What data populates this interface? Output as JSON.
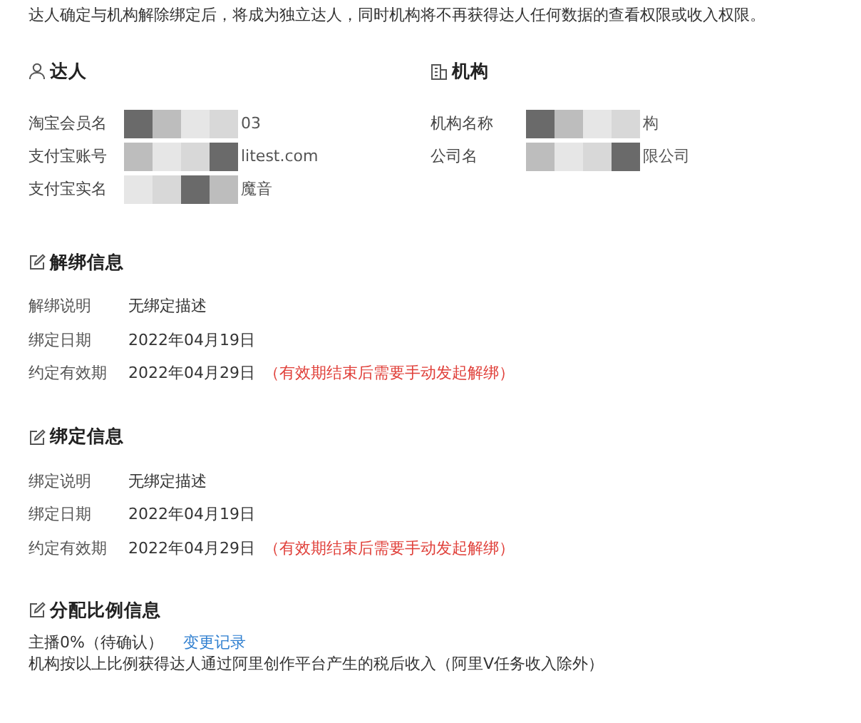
{
  "notice": "达人确定与机构解除绑定后，将成为独立达人，同时机构将不再获得达人任何数据的查看权限或收入权限。",
  "parties": [
    {
      "kind": "person",
      "title": "达人",
      "fields": [
        {
          "label": "淘宝会员名",
          "value": "03",
          "masked": true
        },
        {
          "label": "支付宝账号",
          "value": "litest.com",
          "masked": true
        },
        {
          "label": "支付宝实名",
          "value": "魔音",
          "masked": true
        }
      ]
    },
    {
      "kind": "org",
      "title": "机构",
      "fields": [
        {
          "label": "机构名称",
          "value": "构",
          "masked": true
        },
        {
          "label": "公司名",
          "value": "限公司",
          "masked": true
        }
      ]
    }
  ],
  "sections": [
    {
      "title": "解绑信息",
      "rows": [
        {
          "label": "解绑说明",
          "value": "无绑定描述"
        },
        {
          "label": "绑定日期",
          "value": "2022年04月19日"
        },
        {
          "label": "约定有效期",
          "value": "2022年04月29日",
          "note": "（有效期结束后需要手动发起解绑）"
        }
      ]
    },
    {
      "title": "绑定信息",
      "rows": [
        {
          "label": "绑定说明",
          "value": "无绑定描述"
        },
        {
          "label": "绑定日期",
          "value": "2022年04月19日"
        },
        {
          "label": "约定有效期",
          "value": "2022年04月29日",
          "note": "（有效期结束后需要手动发起解绑）"
        }
      ]
    }
  ],
  "share": {
    "title": "分配比例信息",
    "ratio": "主播0%（待确认）",
    "link": "变更记录",
    "description": "机构按以上比例获得达人通过阿里创作平台产生的税后收入（阿里V任务收入除外）"
  }
}
